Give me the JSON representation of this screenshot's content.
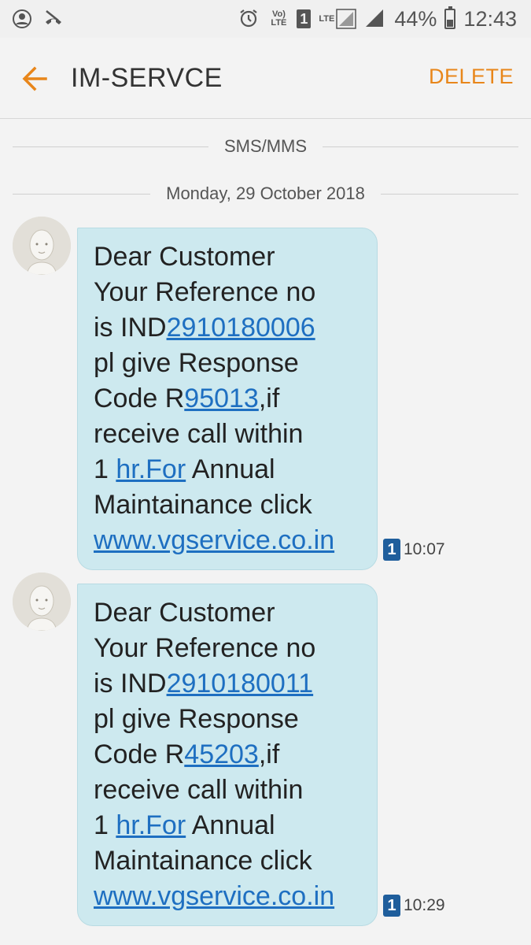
{
  "status_bar": {
    "battery": "44%",
    "time": "12:43",
    "volte": "Vo) LTE",
    "lte": "LTE",
    "sim_slot": "1",
    "battery_level": 0.44,
    "icons": [
      "notification-icon",
      "missed-call-icon",
      "alarm-icon",
      "volte-icon",
      "sim-icon",
      "lte-signal-icon",
      "signal-icon",
      "battery-icon"
    ]
  },
  "app_bar": {
    "title": "IM-SERVCE",
    "delete_label": "DELETE",
    "back_icon": "arrow-left-icon",
    "accent_color": "#e8861a"
  },
  "thread": {
    "channel_label": "SMS/MMS",
    "date_label": "Monday, 29 October 2018",
    "messages": [
      {
        "lines": {
          "l1": "Dear Customer",
          "l2": "Your Reference no",
          "l3_pre": "is IND",
          "l3_link": "2910180006",
          "l4": "pl give Response",
          "l5_pre": "Code R",
          "l5_link": "95013",
          "l5_post": ",if",
          "l6": "receive call within",
          "l7_pre": "1 ",
          "l7_link": "hr.For",
          "l7_post": " Annual",
          "l8": "Maintainance click",
          "l9_link": "www.vgservice.co.in"
        },
        "sim": "1",
        "time": "10:07"
      },
      {
        "lines": {
          "l1": "Dear Customer",
          "l2": "Your Reference no",
          "l3_pre": "is IND",
          "l3_link": "2910180011",
          "l4": "pl give Response",
          "l5_pre": "Code R",
          "l5_link": "45203",
          "l5_post": ",if",
          "l6": "receive call within",
          "l7_pre": "1 ",
          "l7_link": "hr.For",
          "l7_post": " Annual",
          "l8": "Maintainance click",
          "l9_link": "www.vgservice.co.in"
        },
        "sim": "1",
        "time": "10:29"
      }
    ],
    "bubble_color": "#cde9ef",
    "link_color": "#1e6fc1"
  }
}
